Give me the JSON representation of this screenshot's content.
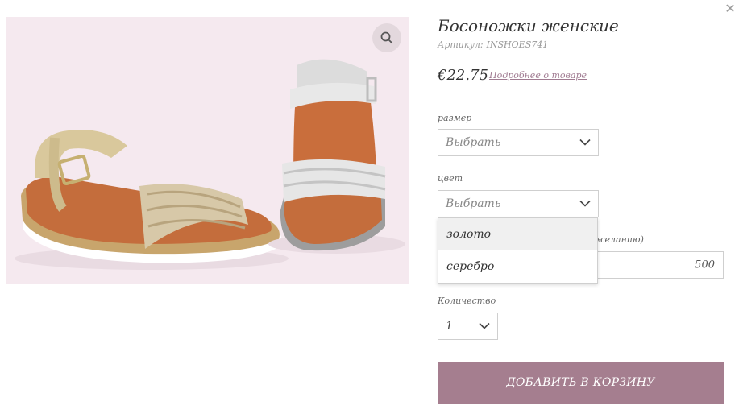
{
  "product": {
    "title": "Босоножки женские",
    "sku_label": "Артикул:",
    "sku_value": "INSHOES741",
    "price": "€22.75",
    "details_link": "Подробнее о товаре"
  },
  "options": {
    "size": {
      "label": "размер",
      "value": "Выбрать"
    },
    "color": {
      "label": "цвет",
      "value": "Выбрать",
      "options": [
        "золото",
        "серебро"
      ]
    },
    "custom": {
      "label_fragment": "желанию)",
      "value": "500"
    },
    "quantity": {
      "label": "Количество",
      "value": "1"
    }
  },
  "cart": {
    "add_label": "ДОБАВИТЬ В КОРЗИНУ"
  },
  "icons": {
    "close": "close-icon",
    "zoom": "magnifier-icon",
    "chevron": "chevron-down-icon"
  },
  "colors": {
    "accent": "#a57e8f",
    "link": "#a07b91",
    "image_bg": "#f3e6ec"
  }
}
